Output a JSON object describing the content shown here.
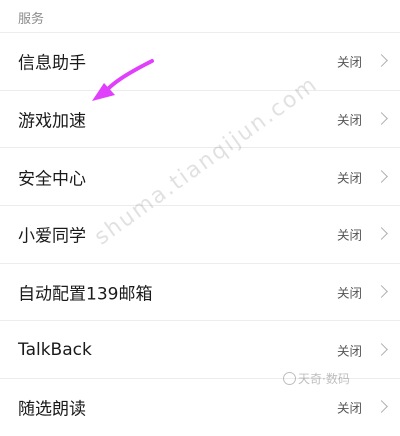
{
  "section": {
    "title": "服务"
  },
  "items": [
    {
      "label": "信息助手",
      "status": "关闭"
    },
    {
      "label": "游戏加速",
      "status": "关闭"
    },
    {
      "label": "安全中心",
      "status": "关闭"
    },
    {
      "label": "小爱同学",
      "status": "关闭"
    },
    {
      "label": "自动配置139邮箱",
      "status": "关闭"
    },
    {
      "label": "TalkBack",
      "status": "关闭"
    },
    {
      "label": "随选朗读",
      "status": "关闭"
    }
  ],
  "watermark": {
    "text": "shuma.tianqijun.com",
    "logo_text": "天奇·数码"
  },
  "colors": {
    "annotation_arrow": "#e040fb",
    "divider": "#ececec",
    "status_text": "#555555",
    "chevron": "#b0b0b0"
  },
  "icons": {
    "chevron": "chevron-right-icon",
    "arrow": "annotation-arrow"
  }
}
